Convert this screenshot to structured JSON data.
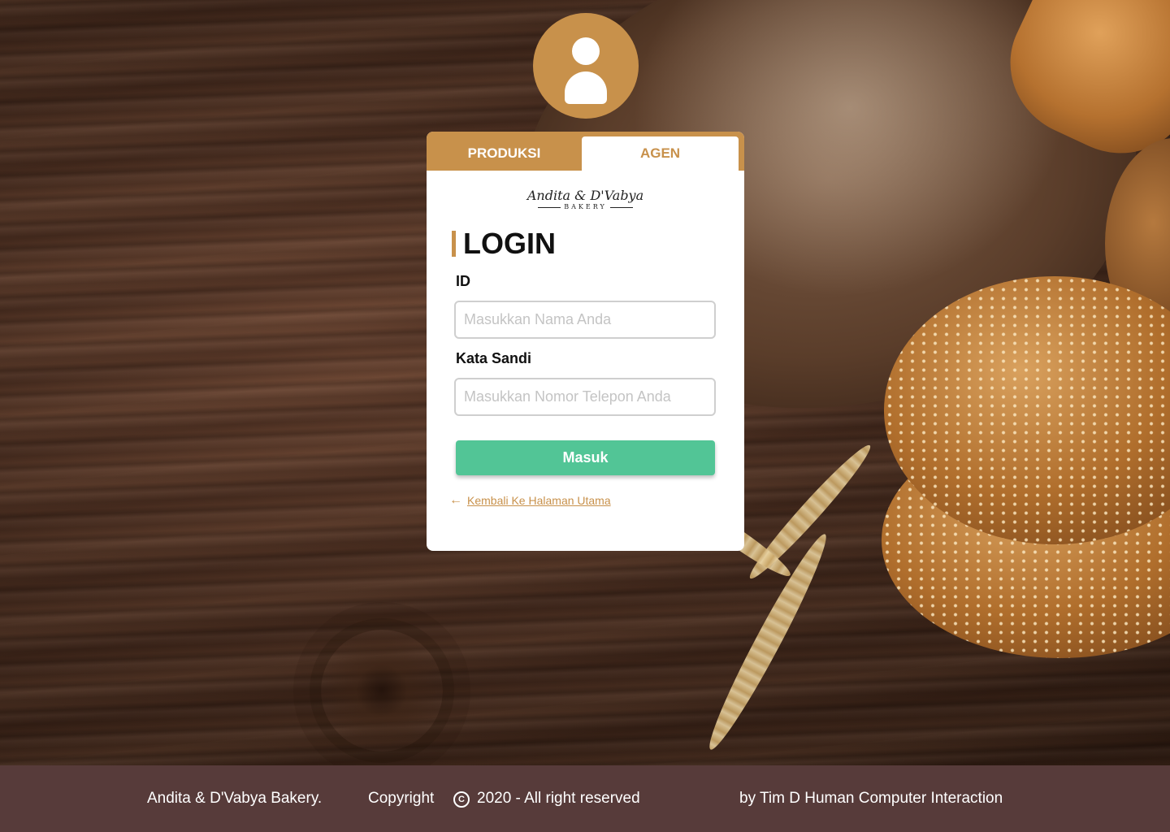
{
  "tabs": {
    "produksi": "PRODUKSI",
    "agen": "AGEN",
    "active": "AGEN"
  },
  "logo": {
    "script": "Andita & D'Vabya",
    "sub": "BAKERY"
  },
  "login": {
    "title": "LOGIN",
    "id_label": "ID",
    "id_placeholder": "Masukkan Nama Anda",
    "password_label": "Kata Sandi",
    "password_placeholder": "Masukkan Nomor Telepon Anda",
    "submit_label": "Masuk",
    "back_label": "Kembali Ke Halaman Utama"
  },
  "footer": {
    "brand": "Andita & D'Vabya Bakery.",
    "copyright": "Copyright",
    "copyright_symbol": "C",
    "year_text": "2020 - All right reserved",
    "credit": "by Tim D Human Computer Interaction"
  },
  "colors": {
    "accent": "#c8914b",
    "button": "#52c596",
    "footer_bg": "#573b3a"
  },
  "icons": {
    "avatar": "user-avatar-icon",
    "back": "arrow-left-icon",
    "copyright": "copyright-icon"
  }
}
